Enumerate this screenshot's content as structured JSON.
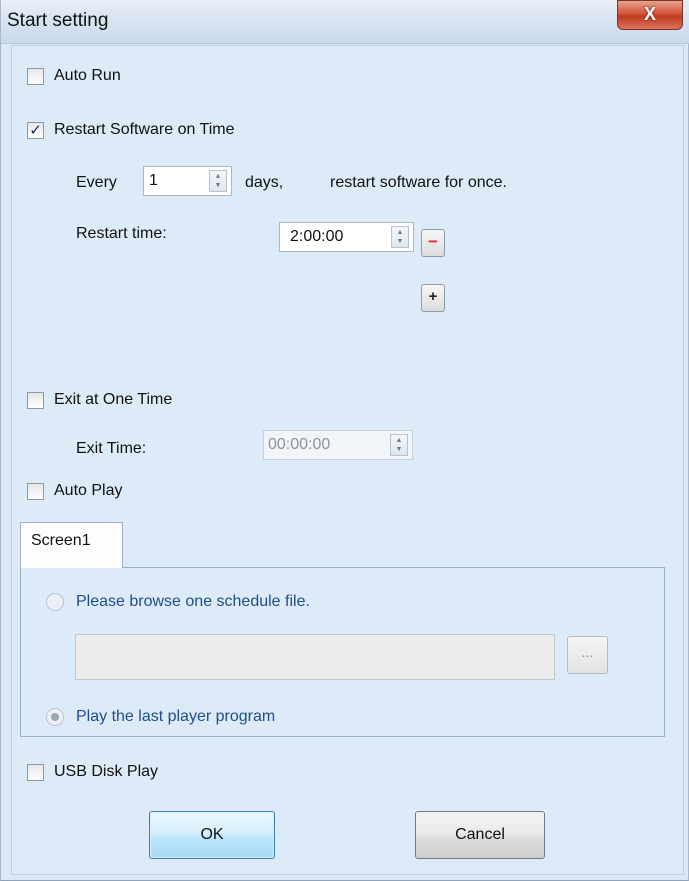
{
  "window": {
    "title": "Start setting",
    "close_label": "X"
  },
  "auto_run": {
    "label": "Auto Run",
    "checked": false
  },
  "restart": {
    "label": "Restart Software on Time",
    "checked": true,
    "check_mark": "✓",
    "every_label": "Every",
    "days_value": "1",
    "days_label": "days,",
    "suffix_label": "restart software for once.",
    "time_label": "Restart time:",
    "time_value": "2:00:00",
    "remove_label": "−",
    "add_label": "+"
  },
  "exit": {
    "label": "Exit at One Time",
    "checked": false,
    "time_label": "Exit Time:",
    "time_value": "00:00:00"
  },
  "auto_play": {
    "label": "Auto Play",
    "checked": false,
    "tab_label": "Screen1",
    "option_browse": "Please browse one schedule file.",
    "file_value": "",
    "browse_button": "...",
    "option_last": "Play the last player program"
  },
  "usb": {
    "label": "USB Disk Play",
    "checked": false
  },
  "buttons": {
    "ok": "OK",
    "cancel": "Cancel"
  },
  "colors": {
    "background": "#dbe8f6",
    "link_text": "#1d4f88",
    "minus": "#e02a2a",
    "close": "#c23a1f"
  },
  "icons": {
    "check": "checkmark-icon",
    "spin": "spin-arrows-icon",
    "close": "close-icon"
  }
}
